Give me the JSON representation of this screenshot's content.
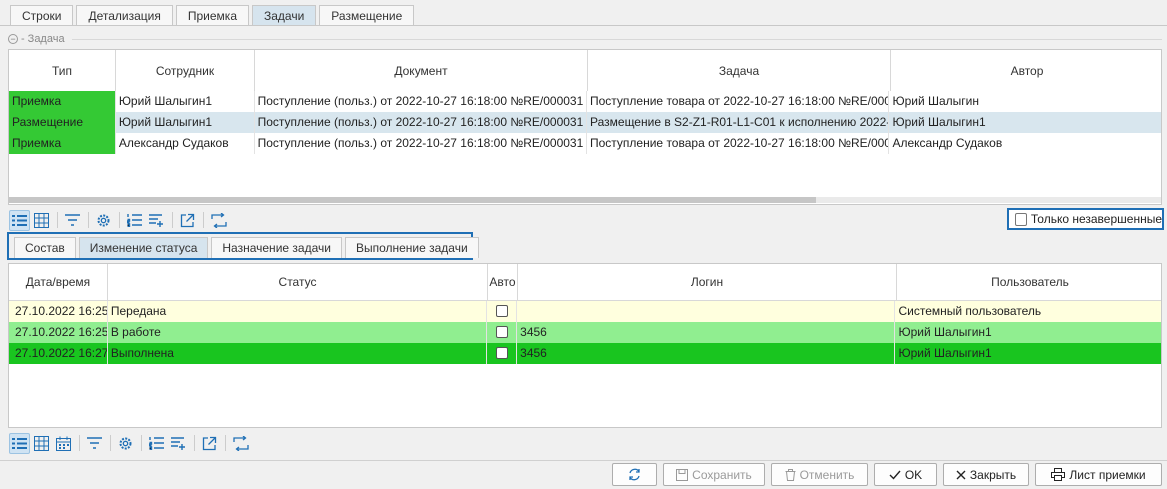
{
  "tabs": [
    "Строки",
    "Детализация",
    "Приемка",
    "Задачи",
    "Размещение"
  ],
  "active_tab": 3,
  "section_title": "Задача",
  "tasks": {
    "columns": [
      "Тип",
      "Сотрудник",
      "Документ",
      "Задача",
      "Автор"
    ],
    "rows": [
      {
        "type": "Приемка",
        "employee": "Юрий Шалыгин1",
        "document": "Поступление (польз.) от 2022-10-27 16:18:00 №RE/000031",
        "task": "Поступление товара от 2022-10-27 16:18:00 №RE/0000",
        "author": "Юрий Шалыгин"
      },
      {
        "type": "Размещение",
        "employee": "Юрий Шалыгин1",
        "document": "Поступление (польз.) от 2022-10-27 16:18:00 №RE/000031",
        "task": "Размещение в S2-Z1-R01-L1-C01 к исполнению 2022-1",
        "author": "Юрий Шалыгин1"
      },
      {
        "type": "Приемка",
        "employee": "Александр Судаков",
        "document": "Поступление (польз.) от 2022-10-27 16:18:00 №RE/000031",
        "task": "Поступление товара от 2022-10-27 16:18:00 №RE/0000",
        "author": "Александр Судаков"
      }
    ],
    "selected_row": 1
  },
  "only_unfinished": {
    "label": "Только незавершенные",
    "checked": false
  },
  "subtabs": [
    "Состав",
    "Изменение статуса",
    "Назначение задачи",
    "Выполнение задачи"
  ],
  "active_subtab": 1,
  "status": {
    "columns": [
      "Дата/время",
      "Статус",
      "Авто",
      "Логин",
      "Пользователь"
    ],
    "rows": [
      {
        "datetime": "27.10.2022 16:25",
        "status": "Передана",
        "auto": false,
        "login": "",
        "user": "Системный пользователь",
        "color": "#ffffde"
      },
      {
        "datetime": "27.10.2022 16:25",
        "status": "В работе",
        "auto": false,
        "login": "3456",
        "user": "Юрий Шалыгин1",
        "color": "#90ee90"
      },
      {
        "datetime": "27.10.2022 16:27",
        "status": "Выполнена",
        "auto": false,
        "login": "3456",
        "user": "Юрий Шалыгин1",
        "color": "#19c51f"
      }
    ]
  },
  "colors": {
    "accent": "#1f6fb5",
    "type_green": "#34c934",
    "selected_row": "#d8e6ee"
  },
  "buttons": {
    "refresh": "",
    "save": "Сохранить",
    "cancel": "Отменить",
    "ok": "OK",
    "close": "Закрыть",
    "receipt_sheet": "Лист приемки"
  }
}
